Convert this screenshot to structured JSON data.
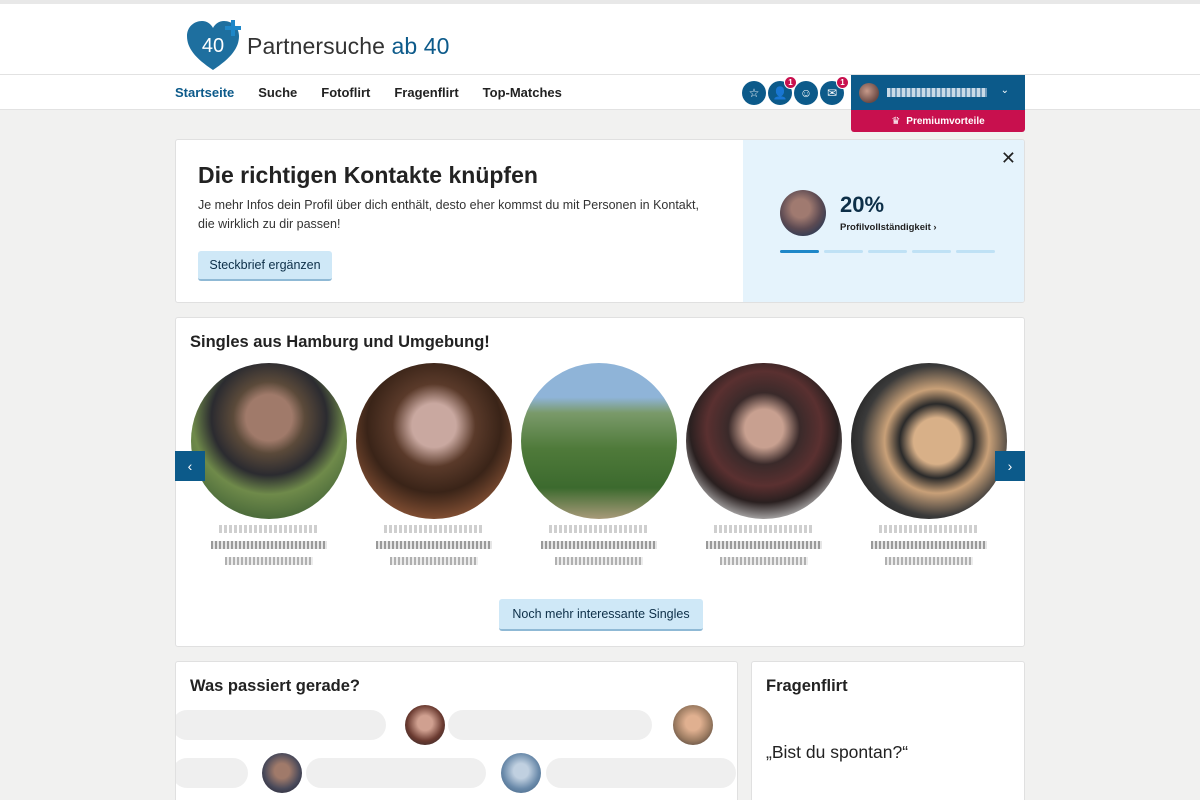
{
  "brand": {
    "logo_number": "40",
    "name_main": "Partnersuche ",
    "name_accent": "ab 40",
    "accent_color": "#0c5a8a",
    "premium_color": "#c8104e"
  },
  "nav": {
    "items": [
      {
        "label": "Startseite",
        "active": true
      },
      {
        "label": "Suche",
        "active": false
      },
      {
        "label": "Fotoflirt",
        "active": false
      },
      {
        "label": "Fragenflirt",
        "active": false
      },
      {
        "label": "Top-Matches",
        "active": false
      }
    ],
    "icons": [
      {
        "name": "star-icon",
        "glyph": "☆",
        "badge": ""
      },
      {
        "name": "visitors-icon",
        "glyph": "👤",
        "badge": "1"
      },
      {
        "name": "smiley-icon",
        "glyph": "☺",
        "badge": ""
      },
      {
        "name": "mail-icon",
        "glyph": "✉",
        "badge": "1"
      }
    ],
    "premium_label": "Premiumvorteile"
  },
  "banner": {
    "title": "Die richtigen Kontakte knüpfen",
    "text": "Je mehr Infos dein Profil über dich enthält, desto eher kommst du mit Personen in Kontakt, die wirklich zu dir passen!",
    "button": "Steckbrief ergänzen",
    "percent": "20%",
    "percent_label": "Profilvollständigkeit ›",
    "progress_segments": 5,
    "progress_filled": 1
  },
  "singles": {
    "title": "Singles aus Hamburg und Umgebung!",
    "button": "Noch mehr interessante Singles"
  },
  "activity": {
    "title": "Was passiert gerade?"
  },
  "fragenflirt": {
    "title": "Fragenflirt",
    "question": "„Bist du spontan?“"
  }
}
